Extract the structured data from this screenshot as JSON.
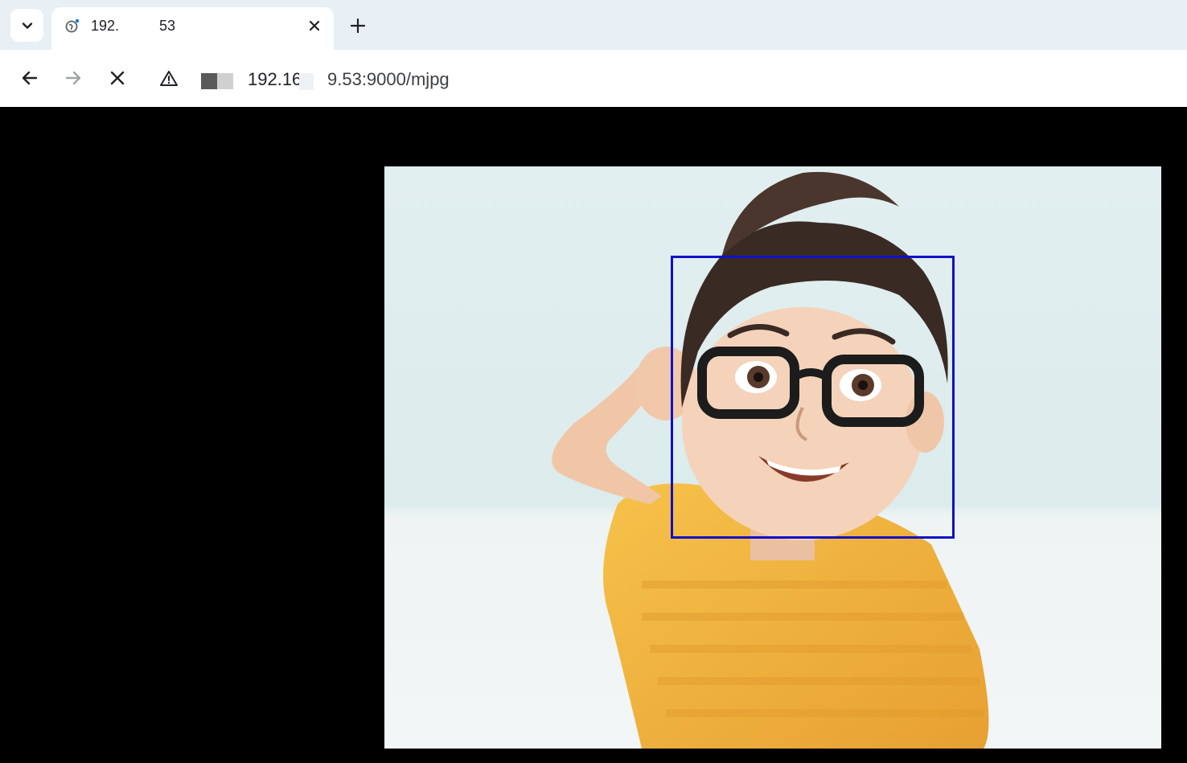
{
  "tab_strip": {
    "tab_title": "192.          53",
    "icons": {
      "search_tabs": "chevron-down-icon",
      "favicon": "globe-loading-icon",
      "close": "close-icon",
      "new_tab": "plus-icon"
    }
  },
  "toolbar": {
    "icons": {
      "back": "arrow-left-icon",
      "forward": "arrow-right-icon",
      "stop": "close-icon",
      "security": "warning-triangle-icon"
    },
    "url_visible_part_1": "192.16",
    "url_visible_part_2": "9.53:9000/mjpg"
  },
  "content": {
    "stream_image": "cartoon-boy-with-glasses",
    "detection_box_color": "#1010c8",
    "background_color": "#000000"
  }
}
